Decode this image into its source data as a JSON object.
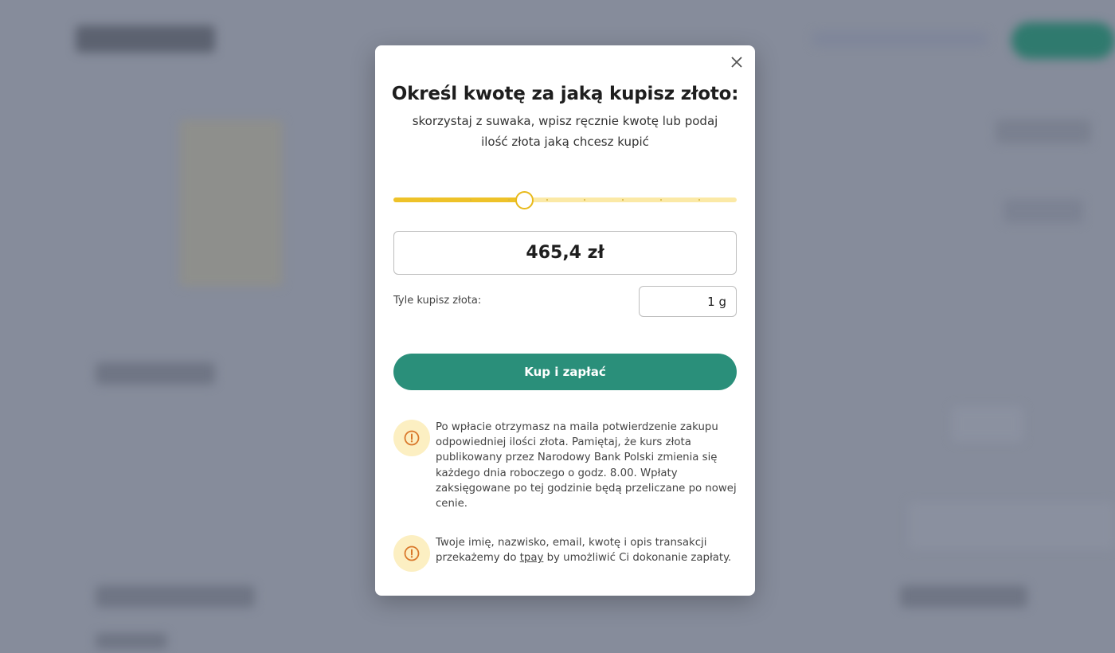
{
  "modal": {
    "title": "Określ kwotę za jaką kupisz złoto:",
    "subtitle": "skorzystaj z suwaka, wpisz ręcznie kwotę lub podaj ilość złota jaką chcesz kupić",
    "close_icon": "close-icon",
    "slider": {
      "value_fraction": 0.38,
      "tick_count": 9
    },
    "amount_value": "465,4 zł",
    "gold_label": "Tyle kupisz złota:",
    "gold_value": "1 g",
    "buy_button_label": "Kup i zapłać",
    "note1": {
      "icon": "exclamation-circle-icon",
      "text": "Po wpłacie otrzymasz na maila potwierdzenie zakupu odpowiedniej ilości złota. Pamiętaj, że kurs złota publikowany przez Narodowy Bank Polski zmienia się każdego dnia roboczego o godz. 8.00. Wpłaty zaksięgowane po tej godzinie będą przeliczane po nowej cenie."
    },
    "note2": {
      "icon": "exclamation-circle-icon",
      "text_before": "Twoje imię, nazwisko, email, kwotę i opis transakcji przekażemy do ",
      "link": "tpay",
      "text_after": " by umożliwić Ci dokonanie zapłaty."
    }
  },
  "colors": {
    "accent_green": "#2a8f7a",
    "slider_yellow": "#eec229",
    "icon_orange": "#d9772a"
  }
}
